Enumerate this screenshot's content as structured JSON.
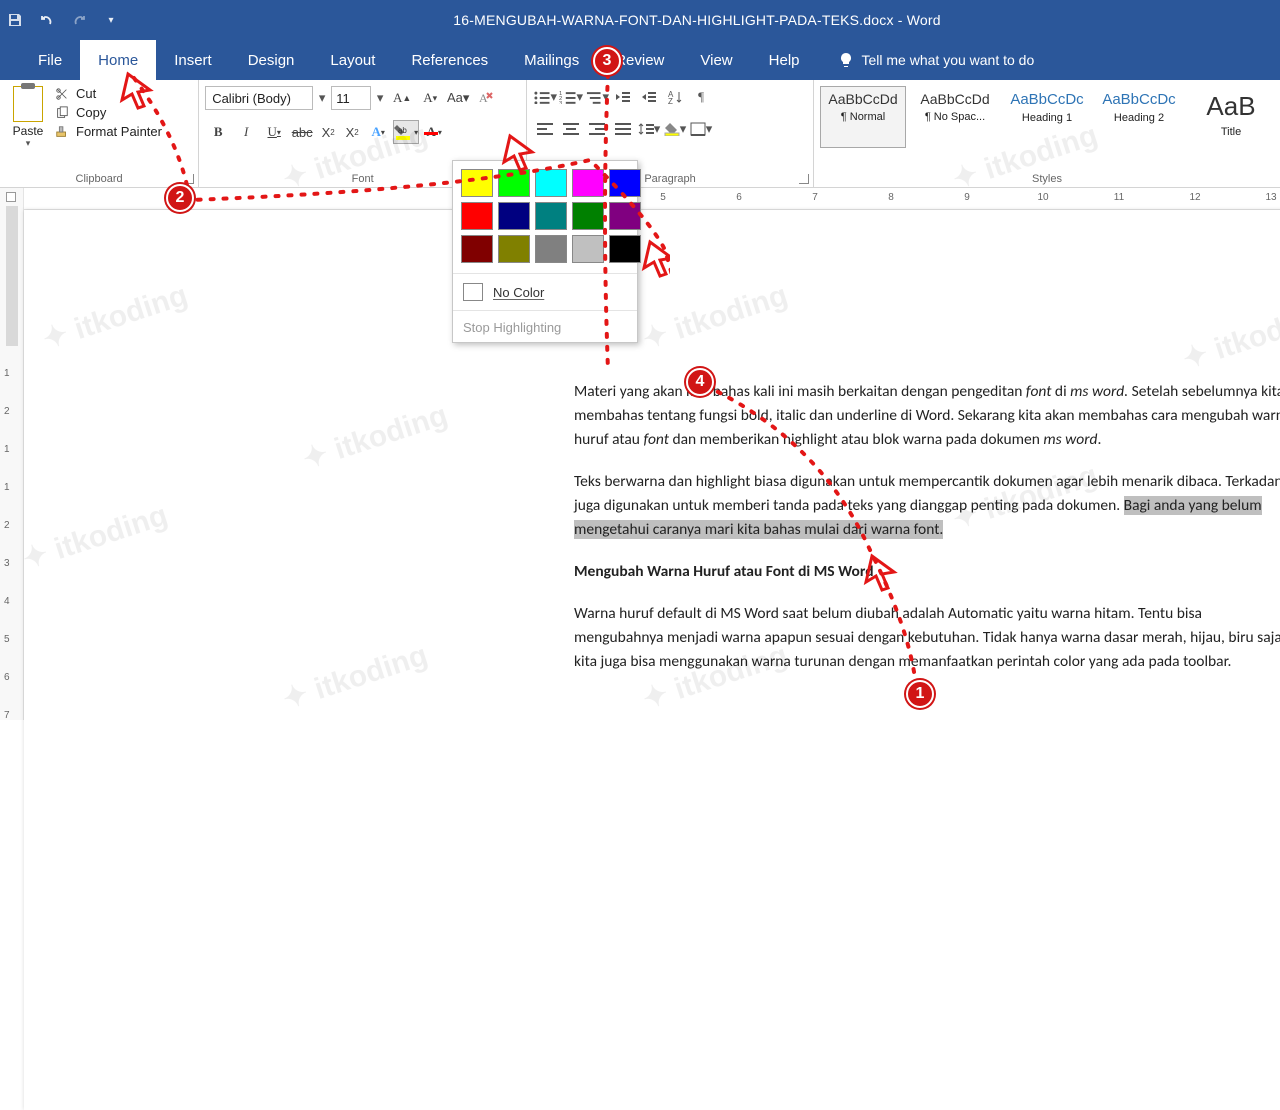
{
  "titlebar": {
    "title": "16-MENGUBAH-WARNA-FONT-DAN-HIGHLIGHT-PADA-TEKS.docx  -  Word"
  },
  "tabs": {
    "file": "File",
    "home": "Home",
    "insert": "Insert",
    "design": "Design",
    "layout": "Layout",
    "references": "References",
    "mailings": "Mailings",
    "review": "Review",
    "view": "View",
    "help": "Help",
    "tellme": "Tell me what you want to do"
  },
  "clipboard": {
    "paste": "Paste",
    "cut": "Cut",
    "copy": "Copy",
    "format_painter": "Format Painter",
    "group_label": "Clipboard"
  },
  "font": {
    "name": "Calibri (Body)",
    "size": "11",
    "group_label": "Font"
  },
  "paragraph": {
    "group_label": "Paragraph"
  },
  "styles": {
    "group_label": "Styles",
    "items": [
      {
        "preview": "AaBbCcDd",
        "label": "¶ Normal"
      },
      {
        "preview": "AaBbCcDd",
        "label": "¶ No Spac..."
      },
      {
        "preview": "AaBbCcDc",
        "label": "Heading 1"
      },
      {
        "preview": "AaBbCcDc",
        "label": "Heading 2"
      },
      {
        "preview": "AaB",
        "label": "Title"
      }
    ]
  },
  "highlight_popup": {
    "colors": [
      "#ffff00",
      "#00ff00",
      "#00ffff",
      "#ff00ff",
      "#0000ff",
      "#ff0000",
      "#000080",
      "#008080",
      "#008000",
      "#800080",
      "#800000",
      "#808000",
      "#808080",
      "#c0c0c0",
      "#000000"
    ],
    "no_color": "No Color",
    "stop": "Stop Highlighting"
  },
  "ruler": {
    "numbers": [
      "5",
      "",
      "6",
      "",
      "7",
      "",
      "8",
      "",
      "9",
      "",
      "10",
      "",
      "11",
      "",
      "12",
      "",
      "13"
    ]
  },
  "vruler": {
    "numbers": [
      "1",
      "2",
      "1",
      "1",
      "2",
      "3",
      "4",
      "5",
      "6",
      "7"
    ]
  },
  "document": {
    "p1_a": "Materi yang akan kita bahas kali ini masih berkaitan dengan pengeditan ",
    "p1_b": "font",
    "p1_c": " di ",
    "p1_d": "ms word.",
    "p1_e": " Setelah sebelumnya kita membahas tentang fungsi bold, italic dan underline di Word. Sekarang kita akan membahas cara mengubah warna huruf atau ",
    "p1_f": "font",
    "p1_g": " dan memberikan highlight atau blok warna pada dokumen ",
    "p1_h": "ms word",
    "p1_i": ".",
    "p2_a": "Teks berwarna dan highlight biasa digunakan untuk mempercantik dokumen agar lebih menarik dibaca. Terkadang juga digunakan untuk memberi tanda pada teks yang dianggap penting pada dokumen. ",
    "p2_sel": "Bagi anda yang belum mengetahui caranya mari kita bahas mulai dari warna font.",
    "h1": "Mengubah Warna Huruf atau Font di MS Word",
    "p3": "Warna huruf default di MS Word saat belum diubah adalah Automatic yaitu warna hitam. Tentu bisa mengubahnya menjadi warna apapun sesuai dengan kebutuhan. Tidak hanya warna dasar merah, hijau, biru saja, kita juga bisa menggunakan warna turunan dengan memanfaatkan perintah color yang ada pada toolbar."
  },
  "annotations": {
    "m1": "1",
    "m2": "2",
    "m3": "3",
    "m4": "4"
  },
  "watermark": "itkoding"
}
